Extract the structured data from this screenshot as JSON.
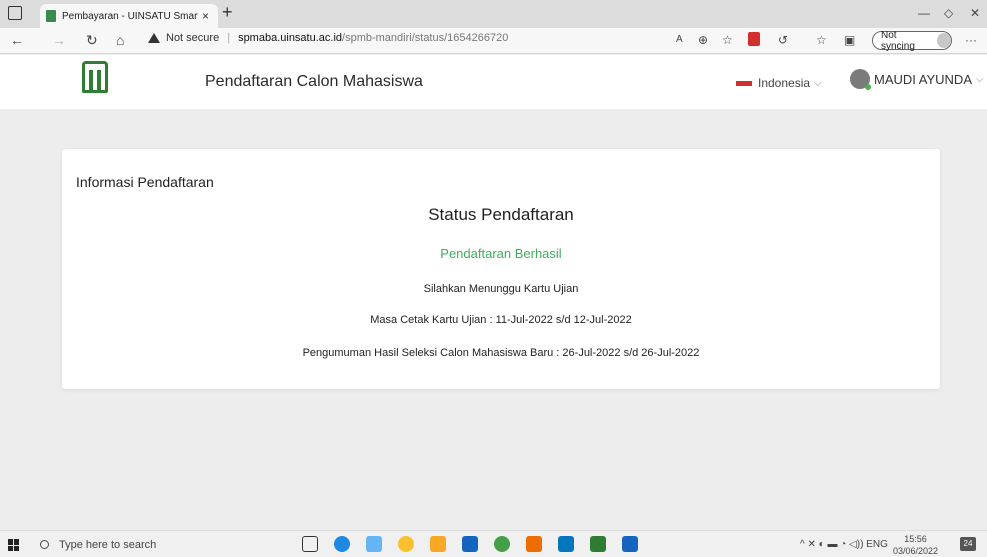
{
  "browser": {
    "tab_title": "Pembayaran - UINSATU SmartCa",
    "tab_close": "×",
    "new_tab": "+",
    "not_secure": "Not secure",
    "url_host": "spmaba.uinsatu.ac.id",
    "url_path": "/spmb-mandiri/status/1654266720",
    "sync_label": "Not syncing",
    "more": "···",
    "icons": {
      "back": "back-arrow-icon",
      "forward": "forward-arrow-icon",
      "refresh": "refresh-icon",
      "home": "home-icon"
    }
  },
  "header": {
    "site_title": "Pendaftaran Calon Mahasiswa",
    "language": "Indonesia",
    "user_name": "MAUDI AYUNDA"
  },
  "card": {
    "heading": "Informasi Pendaftaran",
    "status_title": "Status Pendaftaran",
    "status_result": "Pendaftaran Berhasil",
    "message": "Silahkan Menunggu Kartu Ujian",
    "print_period": "Masa Cetak Kartu Ujian : 11-Jul-2022 s/d 12-Jul-2022",
    "announcement": "Pengumuman Hasil Seleksi Calon Mahasiswa Baru : 26-Jul-2022 s/d 26-Jul-2022"
  },
  "colors": {
    "success": "#3fae5a",
    "brand": "#2e7d32"
  },
  "taskbar": {
    "search_placeholder": "Type here to search",
    "lang": "ENG",
    "time": "15:56",
    "date": "03/06/2022",
    "notification_count": "24"
  }
}
